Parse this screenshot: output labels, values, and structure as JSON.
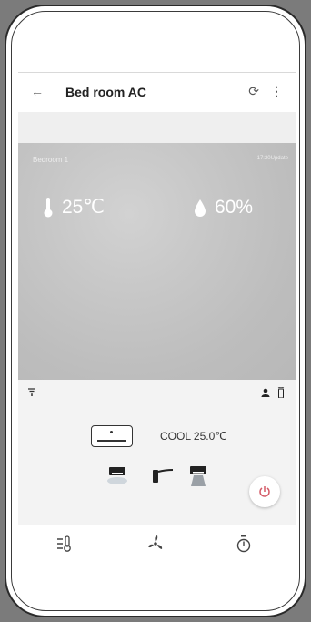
{
  "appbar": {
    "back_icon": "arrow-left-icon",
    "title": "Bed room AC",
    "refresh_icon": "refresh-icon",
    "more_icon": "more-vert-icon"
  },
  "hero": {
    "room": "Bedroom 1",
    "update": "17:20Update",
    "temperature": "25℃",
    "humidity": "60%"
  },
  "control": {
    "mode_text": "COOL 25.0℃",
    "icons": [
      "wifi-signal-icon",
      "person-icon",
      "remote-icon",
      "ac-unit-icon",
      "swing-down-icon",
      "fan-direction-icon",
      "swing-side-icon",
      "power-icon"
    ]
  },
  "bottom_tabs": [
    {
      "icon": "settings-temperature-icon"
    },
    {
      "icon": "fan-icon"
    },
    {
      "icon": "timer-icon"
    }
  ],
  "colors": {
    "background": "#7b7b7b",
    "hero": "#c4c4c4",
    "control": "#f3f3f3"
  }
}
